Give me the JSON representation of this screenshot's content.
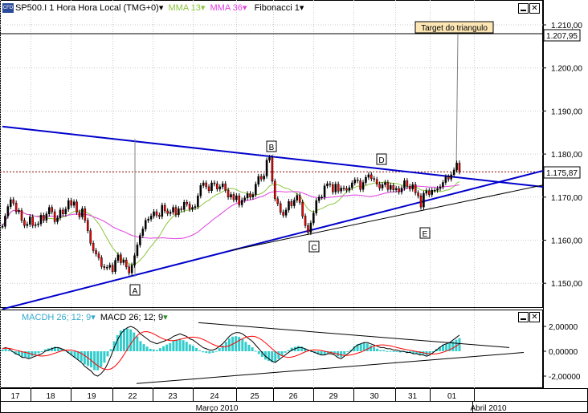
{
  "header": {
    "instrument": "SP500.I",
    "timeframe": "1 Hora Hora Local (TMG+0)",
    "mma13": "MMA 13",
    "mma36": "MMA 36",
    "fibonacci": "Fibonacci 1"
  },
  "macd_header": {
    "macdh": "MACDH 26; 12; 9",
    "macd": "MACD 26; 12; 9"
  },
  "colors": {
    "candle_up": "#000000",
    "candle_down": "#ff0000",
    "mma13": "#8cc63f",
    "mma36": "#e040e0",
    "trendline": "#0000cc",
    "macd_hist": "#33cccc",
    "macd_line": "#000000",
    "signal_line": "#ff0000",
    "current_price": "#8b0000"
  },
  "annotation": {
    "target_label": "Target do triangulo"
  },
  "price_axis": {
    "ticks": [
      "1.210,00",
      "1.200,00",
      "1.190,00",
      "1.180,00",
      "1.170,00",
      "1.160,00",
      "1.150,00"
    ],
    "target_value": "1.207,95",
    "current_value": "1.175,87"
  },
  "macd_axis": {
    "ticks": [
      "2,00000",
      "0,00000",
      "-2,00000"
    ]
  },
  "time_axis": {
    "days": [
      "17",
      "18",
      "19",
      "22",
      "23",
      "24",
      "25",
      "26",
      "29",
      "30",
      "31",
      "01"
    ],
    "months": [
      "Março 2010",
      "Abril 2010"
    ]
  },
  "points": [
    "A",
    "B",
    "C",
    "D",
    "E"
  ],
  "chart_data": {
    "type": "line",
    "title": "SP500.I 1 Hora Hora Local (TMG+0)",
    "ylim": [
      1142,
      1214
    ],
    "price": [
      1163.2,
      1165.6,
      1167.8,
      1169.4,
      1168.6,
      1166.6,
      1166.9,
      1164.6,
      1163.4,
      1163.7,
      1165.4,
      1163.4,
      1163.6,
      1163.8,
      1165.8,
      1164.6,
      1166.1,
      1167.6,
      1166.6,
      1164.3,
      1165.2,
      1167.0,
      1166.1,
      1167.2,
      1169.2,
      1168.1,
      1168.9,
      1166.5,
      1165.4,
      1167.3,
      1164.6,
      1162.2,
      1159.3,
      1157.6,
      1156.8,
      1155.9,
      1153.9,
      1153.6,
      1153.7,
      1154.2,
      1152.7,
      1155.3,
      1156.6,
      1154.8,
      1155.4,
      1153.8,
      1152.4,
      1154.2,
      1156.4,
      1158.9,
      1161.1,
      1162.6,
      1164.6,
      1164.9,
      1165.6,
      1166.6,
      1165.8,
      1165.5,
      1168.1,
      1166.8,
      1166.2,
      1166.5,
      1167.6,
      1165.9,
      1167.3,
      1167.1,
      1168.8,
      1168.4,
      1167.2,
      1167.6,
      1167.8,
      1170.3,
      1172.7,
      1173.3,
      1172.4,
      1171.5,
      1173.3,
      1173.1,
      1171.9,
      1172.4,
      1173.1,
      1171.6,
      1170.0,
      1170.6,
      1169.4,
      1170.3,
      1168.2,
      1169.3,
      1169.8,
      1170.8,
      1170.0,
      1170.6,
      1173.0,
      1174.8,
      1174.2,
      1174.9,
      1178.6,
      1179.2,
      1173.7,
      1169.6,
      1168.5,
      1166.5,
      1165.8,
      1167.0,
      1169.0,
      1168.0,
      1169.3,
      1170.4,
      1168.8,
      1165.6,
      1163.4,
      1161.8,
      1164.0,
      1166.3,
      1169.2,
      1170.0,
      1170.0,
      1172.6,
      1173.1,
      1172.9,
      1171.2,
      1173.0,
      1171.4,
      1172.1,
      1172.0,
      1171.6,
      1172.2,
      1173.3,
      1174.0,
      1173.8,
      1171.8,
      1173.4,
      1174.6,
      1175.2,
      1174.3,
      1174.1,
      1173.0,
      1172.1,
      1172.9,
      1173.4,
      1171.8,
      1172.7,
      1171.7,
      1172.0,
      1171.2,
      1172.1,
      1173.8,
      1172.5,
      1171.9,
      1172.9,
      1171.0,
      1170.3,
      1167.7,
      1170.9,
      1171.5,
      1170.6,
      1171.6,
      1171.6,
      1172.0,
      1172.4,
      1173.4,
      1174.7,
      1174.2,
      1175.2,
      1176.3,
      1177.9,
      1175.87
    ],
    "ma13_hint": "green line",
    "ma36_hint": "magenta line",
    "trendlines": [
      {
        "from": [
          0,
          1186.4
        ],
        "to": [
          178,
          1174.0
        ]
      },
      {
        "from": [
          0,
          1144.0
        ],
        "to": [
          178,
          1172.4
        ]
      },
      {
        "from": [
          83,
          1157.6
        ],
        "to": [
          178,
          1169.8
        ]
      }
    ],
    "target_line": {
      "from_value": 1175.87,
      "to_value": 1207.95
    },
    "macd": [
      0.2,
      0.3,
      0.2,
      0.0,
      -0.2,
      -0.3,
      -0.5,
      -0.5,
      -0.6,
      -0.5,
      -0.4,
      -0.3,
      -0.2,
      0.0,
      0.1,
      0.2,
      0.3,
      0.3,
      0.2,
      0.1,
      -0.1,
      -0.3,
      -0.5,
      -0.7,
      -0.9,
      -1.2,
      -1.4,
      -1.6,
      -1.9,
      -2.0,
      -1.8,
      -1.5,
      -1.0,
      -0.4,
      0.3,
      0.9,
      1.4,
      1.7,
      1.9,
      2.0,
      1.9,
      1.7,
      1.4,
      1.2,
      1.0,
      0.8,
      0.7,
      0.6,
      0.7,
      0.8,
      0.9,
      1.0,
      1.2,
      1.3,
      1.4,
      1.3,
      1.2,
      1.0,
      0.9,
      0.7,
      0.5,
      0.3,
      0.2,
      0.1,
      0.1,
      0.2,
      0.4,
      0.6,
      0.9,
      1.2,
      1.4,
      1.5,
      1.5,
      1.4,
      1.2,
      1.0,
      0.8,
      0.5,
      0.2,
      -0.1,
      -0.4,
      -0.6,
      -0.8,
      -0.9,
      -0.7,
      -0.5,
      -0.3,
      -0.1,
      0.1,
      0.2,
      0.3,
      0.3,
      0.2,
      0.1,
      0.0,
      -0.1,
      -0.2,
      -0.3,
      -0.3,
      -0.2,
      -0.2,
      -0.3,
      -0.5,
      -0.6,
      -0.4,
      -0.2,
      0.0,
      0.3,
      0.5,
      0.6,
      0.7,
      0.7,
      0.6,
      0.5,
      0.4,
      0.3,
      0.3,
      0.2,
      0.2,
      0.1,
      0.1,
      0.0,
      0.0,
      -0.1,
      -0.1,
      -0.2,
      -0.2,
      -0.3,
      -0.3,
      -0.4,
      -0.3,
      -0.1,
      0.1,
      0.3,
      0.5,
      0.6,
      0.7,
      0.9,
      1.1,
      1.3
    ],
    "x_categories": [
      "17",
      "18",
      "19",
      "22",
      "23",
      "24",
      "25",
      "26",
      "29",
      "30",
      "31",
      "01"
    ]
  }
}
